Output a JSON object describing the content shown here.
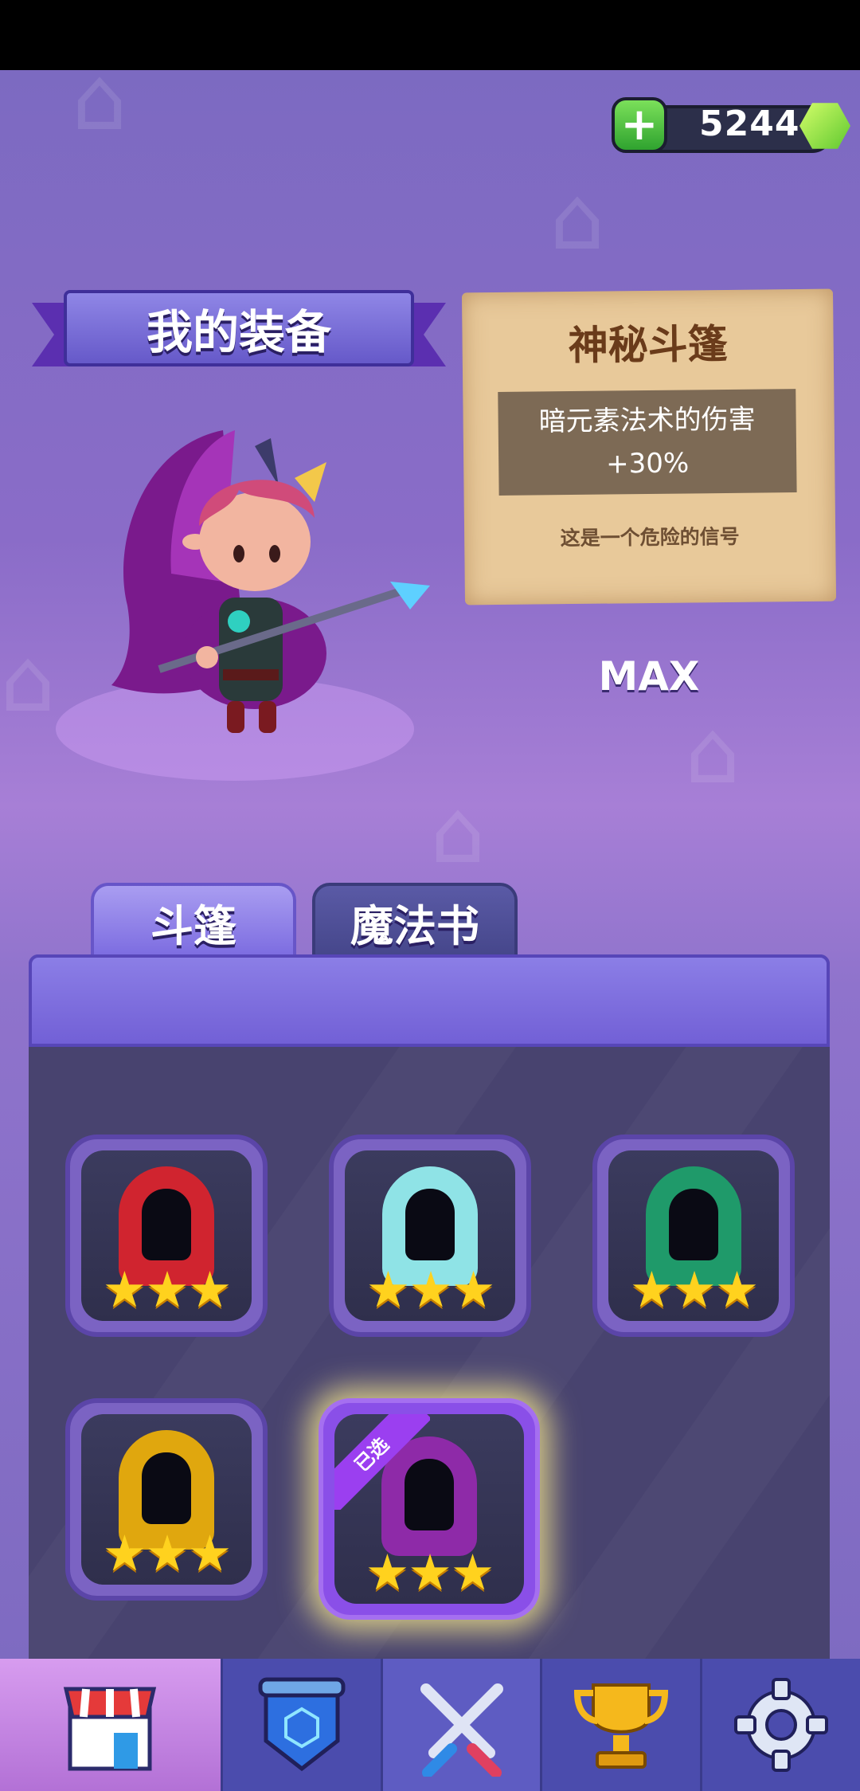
{
  "currency": {
    "plus_label": "+",
    "amount": "5244",
    "icon": "green-gem-icon"
  },
  "header": {
    "title": "我的装备"
  },
  "item_info": {
    "name": "神秘斗篷",
    "effect_line1": "暗元素法术的伤害",
    "effect_line2": "+30%",
    "description": "这是一个危险的信号",
    "level": "MAX"
  },
  "tabs": [
    {
      "label": "斗篷",
      "active": true
    },
    {
      "label": "魔法书",
      "active": false
    }
  ],
  "items": [
    {
      "name": "red-cloak",
      "stars": "★★★",
      "color": "#d0242f",
      "selected": false
    },
    {
      "name": "frost-cloak",
      "stars": "★★★",
      "color": "#8fe3e6",
      "selected": false
    },
    {
      "name": "green-cloak",
      "stars": "★★★",
      "color": "#1f9a6a",
      "selected": false
    },
    {
      "name": "gold-cloak",
      "stars": "★★★",
      "color": "#e0a70e",
      "selected": false
    },
    {
      "name": "mystic-cloak",
      "stars": "★★★",
      "color": "#8e2aa8",
      "selected": true,
      "badge": "已选"
    }
  ],
  "partial_row_stars": "★★★",
  "nav": [
    {
      "name": "shop",
      "icon": "shop-icon",
      "active": true
    },
    {
      "name": "equipment",
      "icon": "shield-icon",
      "active": false
    },
    {
      "name": "battle",
      "icon": "crossed-swords-icon",
      "active": false
    },
    {
      "name": "rank",
      "icon": "trophy-icon",
      "active": false
    },
    {
      "name": "settings",
      "icon": "gear-icon",
      "active": false
    }
  ]
}
